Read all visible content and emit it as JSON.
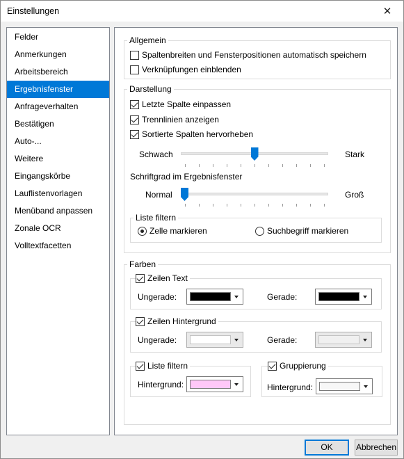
{
  "window": {
    "title": "Einstellungen",
    "close_glyph": "✕"
  },
  "sidebar": {
    "items": [
      {
        "label": "Felder",
        "selected": false
      },
      {
        "label": "Anmerkungen",
        "selected": false
      },
      {
        "label": "Arbeitsbereich",
        "selected": false
      },
      {
        "label": "Ergebnisfenster",
        "selected": true
      },
      {
        "label": "Anfrageverhalten",
        "selected": false
      },
      {
        "label": "Bestätigen",
        "selected": false
      },
      {
        "label": "Auto-...",
        "selected": false
      },
      {
        "label": "Weitere",
        "selected": false
      },
      {
        "label": "Eingangskörbe",
        "selected": false
      },
      {
        "label": "Lauflistenvorlagen",
        "selected": false
      },
      {
        "label": "Menüband anpassen",
        "selected": false
      },
      {
        "label": "Zonale OCR",
        "selected": false
      },
      {
        "label": "Volltextfacetten",
        "selected": false
      }
    ]
  },
  "allgemein": {
    "title": "Allgemein",
    "save_positions": {
      "label": "Spaltenbreiten und Fensterpositionen automatisch speichern",
      "checked": false
    },
    "show_links": {
      "label": "Verknüpfungen einblenden",
      "checked": false
    }
  },
  "darstellung": {
    "title": "Darstellung",
    "fit_last_column": {
      "label": "Letzte Spalte einpassen",
      "checked": true
    },
    "show_gridlines": {
      "label": "Trennlinien anzeigen",
      "checked": true
    },
    "highlight_sorted": {
      "label": "Sortierte Spalten hervorheben",
      "checked": true
    },
    "highlight_slider": {
      "min_label": "Schwach",
      "max_label": "Stark",
      "value": 0.5
    },
    "font_size_label": "Schriftgrad im Ergebnisfenster",
    "font_slider": {
      "min_label": "Normal",
      "max_label": "Groß",
      "value": 0.0
    },
    "liste_filtern": {
      "title": "Liste filtern",
      "option_cell": {
        "label": "Zelle markieren",
        "checked": true
      },
      "option_term": {
        "label": "Suchbegriff markieren",
        "checked": false
      }
    }
  },
  "farben": {
    "title": "Farben",
    "zeilen_text": {
      "label": "Zeilen Text",
      "checked": true,
      "odd_label": "Ungerade:",
      "odd_color": "#000000",
      "even_label": "Gerade:",
      "even_color": "#000000"
    },
    "zeilen_hintergrund": {
      "label": "Zeilen Hintergrund",
      "checked": true,
      "odd_label": "Ungerade:",
      "odd_color": "#ffffff",
      "even_label": "Gerade:",
      "even_color": "#f0f0f0"
    },
    "liste_filtern": {
      "label": "Liste filtern",
      "checked": true,
      "bg_label": "Hintergrund:",
      "bg_color": "#ffc8f8"
    },
    "gruppierung": {
      "label": "Gruppierung",
      "checked": true,
      "bg_label": "Hintergrund:",
      "bg_color": "#f7f7f7"
    }
  },
  "buttons": {
    "ok": "OK",
    "cancel": "Abbrechen"
  }
}
